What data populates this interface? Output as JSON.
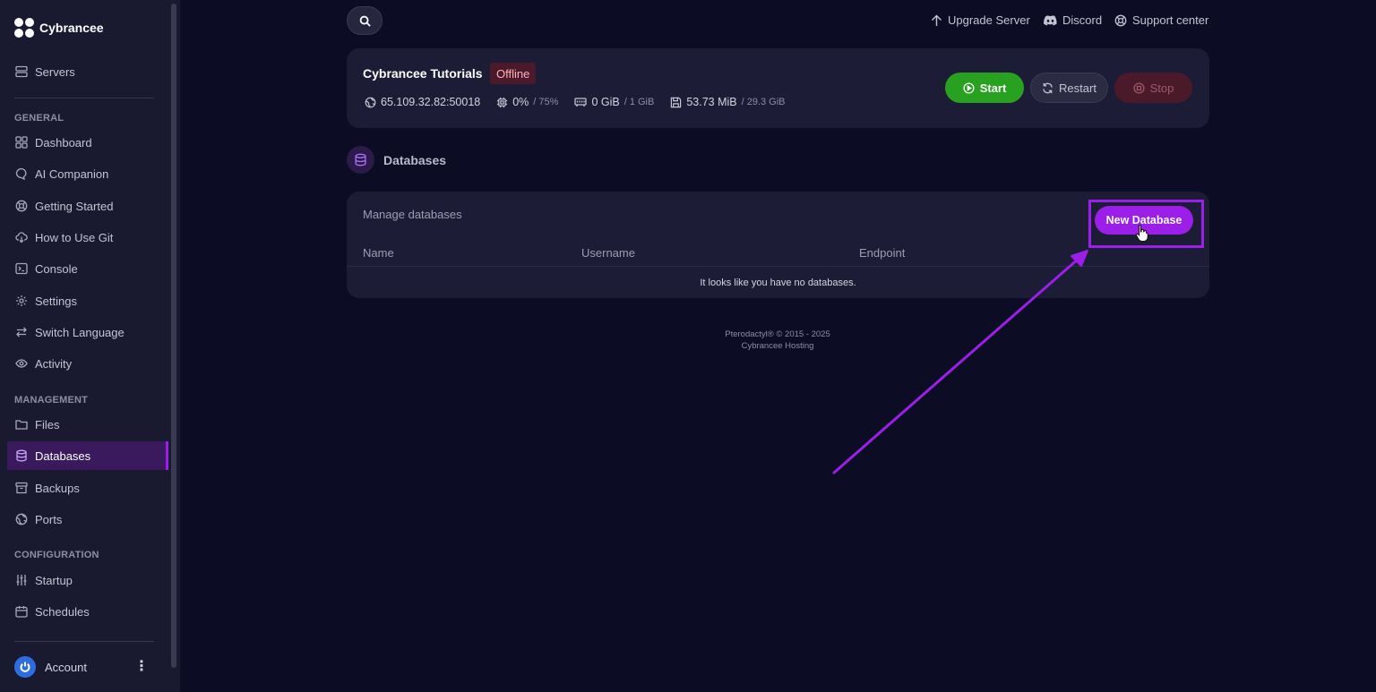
{
  "brand": {
    "name": "Cybrancee"
  },
  "sidebar": {
    "top_item": {
      "label": "Servers",
      "icon": "server-icon"
    },
    "sections": {
      "general": "GENERAL",
      "management": "MANAGEMENT",
      "configuration": "CONFIGURATION"
    },
    "general_items": [
      {
        "label": "Dashboard",
        "icon": "grid-icon"
      },
      {
        "label": "AI Companion",
        "icon": "chat-bubble-icon"
      },
      {
        "label": "Getting Started",
        "icon": "lifebuoy-icon"
      },
      {
        "label": "How to Use Git",
        "icon": "cloud-download-icon"
      },
      {
        "label": "Console",
        "icon": "terminal-icon"
      },
      {
        "label": "Settings",
        "icon": "gear-icon"
      },
      {
        "label": "Switch Language",
        "icon": "swap-arrows-icon"
      },
      {
        "label": "Activity",
        "icon": "eye-icon"
      }
    ],
    "management_items": [
      {
        "label": "Files",
        "icon": "folder-icon"
      },
      {
        "label": "Databases",
        "icon": "database-icon",
        "active": true
      },
      {
        "label": "Backups",
        "icon": "archive-icon"
      },
      {
        "label": "Ports",
        "icon": "globe-icon"
      }
    ],
    "configuration_items": [
      {
        "label": "Startup",
        "icon": "sliders-icon"
      },
      {
        "label": "Schedules",
        "icon": "calendar-icon"
      }
    ],
    "account": {
      "label": "Account",
      "icon": "power-icon"
    }
  },
  "topbar": {
    "links": [
      {
        "label": "Upgrade Server",
        "icon": "arrow-up-icon"
      },
      {
        "label": "Discord",
        "icon": "discord-icon"
      },
      {
        "label": "Support center",
        "icon": "lifebuoy-icon"
      }
    ]
  },
  "server": {
    "name": "Cybrancee Tutorials",
    "status": "Offline",
    "address": "65.109.32.82:50018",
    "cpu": {
      "value": "0%",
      "limit": "/ 75%"
    },
    "memory": {
      "value": "0 GiB",
      "limit": "/ 1 GiB"
    },
    "disk": {
      "value": "53.73 MiB",
      "limit": "/ 29.3 GiB"
    },
    "buttons": {
      "start": "Start",
      "restart": "Restart",
      "stop": "Stop"
    }
  },
  "databases": {
    "title": "Databases",
    "subtitle": "Manage databases",
    "new_button": "New Database",
    "columns": [
      "Name",
      "Username",
      "Endpoint"
    ],
    "empty_message": "It looks like you have no databases."
  },
  "footer": {
    "line1": "Pterodactyl® © 2015 - 2025",
    "line2": "Cybrancee Hosting"
  },
  "colors": {
    "accent": "#9b1fe8",
    "start_green": "#27a11f",
    "offline_badge": "#4a1a2b"
  }
}
